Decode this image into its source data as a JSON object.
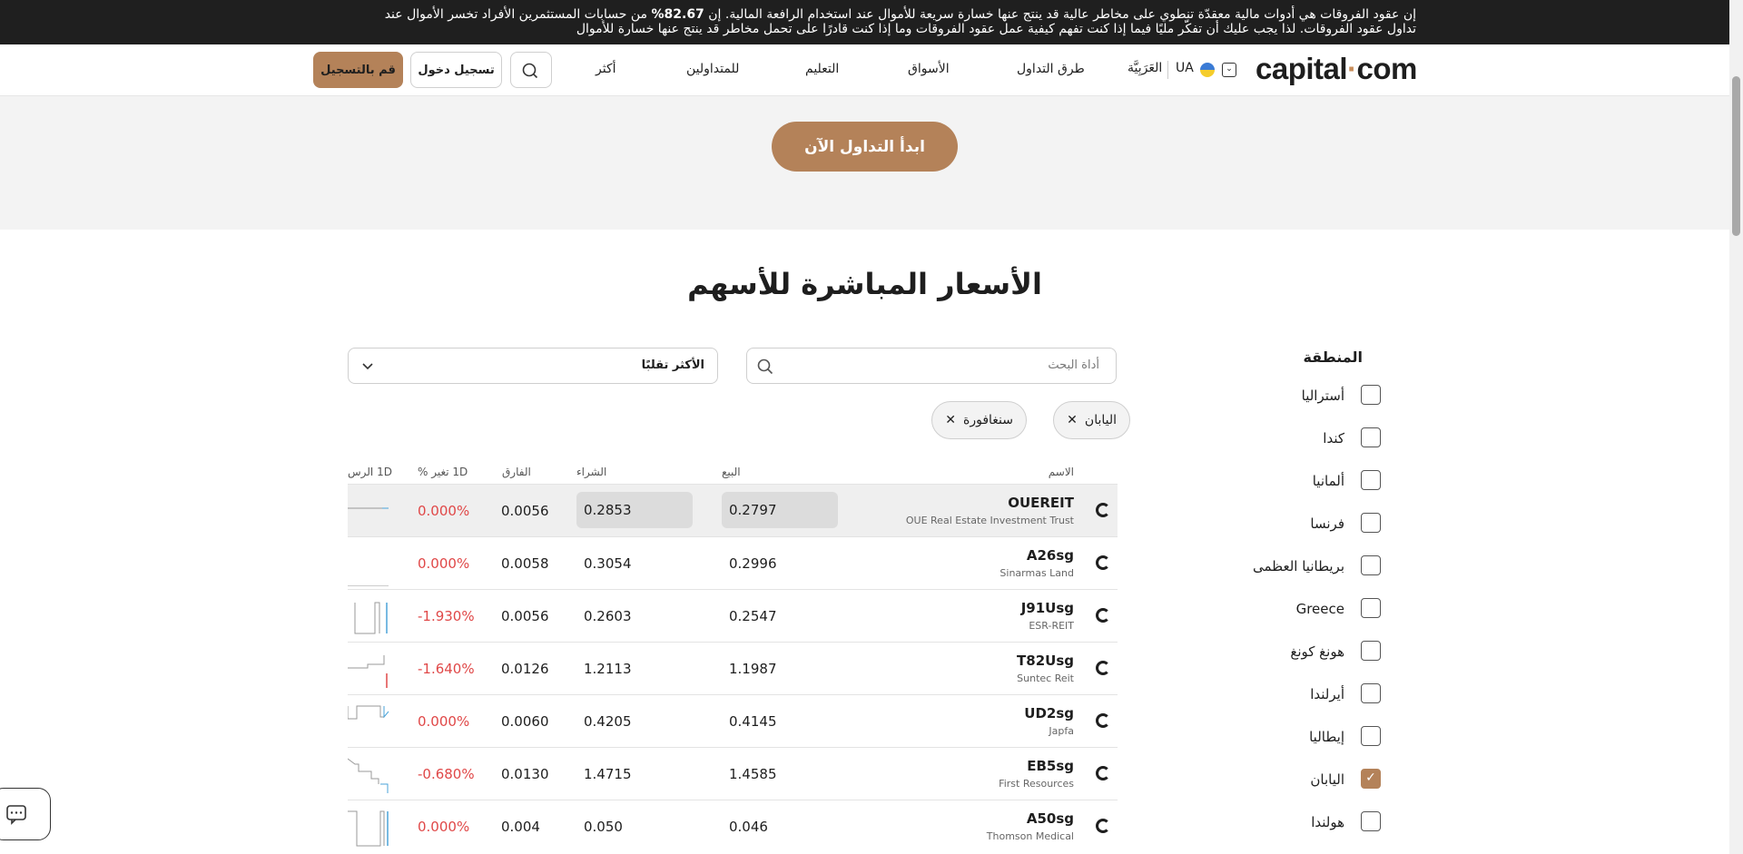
{
  "risk_banner": {
    "before": "إن عقود الفروقات هي أدوات مالية معقدّة تنطوي على مخاطر عالية قد ينتج عنها خسارة سريعة للأموال عند استخدام الرافعة المالية. إن ",
    "percent": "82.67%",
    "after": " من حسابات المستثمرين الأفراد تخسر الأموال عند تداول عقود الفروقات. لذا يجب عليك أن تفكّر مليًا فيما إذا كنت تفهم كيفية عمل عقود الفروقات وما إذا كنت قادرًا على تحمل مخاطر قد ينتج عنها خسارة للأموال"
  },
  "nav": {
    "logo_left": "capital",
    "logo_dot": "·",
    "logo_right": "com",
    "region": "UA",
    "language": "العَرَبِيَّة",
    "items": [
      "طرق التداول",
      "الأسواق",
      "التعليم",
      "للمتداولين",
      "أكثر"
    ],
    "login": "تسجيل دخول",
    "signup": "قم بالتسجيل"
  },
  "hero": {
    "cta": "ابدأ التداول الآن"
  },
  "page_title": "الأسعار المباشرة للأسهم",
  "search": {
    "placeholder": "أداة البحث"
  },
  "sort": {
    "value": "الأكثر تقلبًا"
  },
  "chips": [
    "اليابان",
    "سنغافورة"
  ],
  "filter": {
    "title": "المنطقة",
    "items": [
      {
        "label": "أستراليا",
        "checked": false
      },
      {
        "label": "كندا",
        "checked": false
      },
      {
        "label": "ألمانيا",
        "checked": false
      },
      {
        "label": "فرنسا",
        "checked": false
      },
      {
        "label": "بريطانيا العظمى",
        "checked": false
      },
      {
        "label": "Greece",
        "checked": false
      },
      {
        "label": "هونغ كونغ",
        "checked": false
      },
      {
        "label": "أيرلندا",
        "checked": false
      },
      {
        "label": "إيطاليا",
        "checked": false
      },
      {
        "label": "اليابان",
        "checked": true
      },
      {
        "label": "هولندا",
        "checked": false
      }
    ]
  },
  "table": {
    "headers": {
      "name": "الاسم",
      "sell": "البيع",
      "buy": "الشراء",
      "spread": "الفارق",
      "change": "1D تغير %",
      "chart": "1D الرس"
    },
    "rows": [
      {
        "ticker": "OUEREIT",
        "name": "OUE Real Estate Investment Trust",
        "sell": "0.2797",
        "buy": "0.2853",
        "spread": "0.0056",
        "change": "0.000%"
      },
      {
        "ticker": "A26sg",
        "name": "Sinarmas Land",
        "sell": "0.2996",
        "buy": "0.3054",
        "spread": "0.0058",
        "change": "0.000%"
      },
      {
        "ticker": "J91Usg",
        "name": "ESR-REIT",
        "sell": "0.2547",
        "buy": "0.2603",
        "spread": "0.0056",
        "change": "-1.930%"
      },
      {
        "ticker": "T82Usg",
        "name": "Suntec Reit",
        "sell": "1.1987",
        "buy": "1.2113",
        "spread": "0.0126",
        "change": "-1.640%"
      },
      {
        "ticker": "UD2sg",
        "name": "Japfa",
        "sell": "0.4145",
        "buy": "0.4205",
        "spread": "0.0060",
        "change": "0.000%"
      },
      {
        "ticker": "EB5sg",
        "name": "First Resources",
        "sell": "1.4585",
        "buy": "1.4715",
        "spread": "0.0130",
        "change": "-0.680%"
      },
      {
        "ticker": "A50sg",
        "name": "Thomson Medical",
        "sell": "0.046",
        "buy": "0.050",
        "spread": "0.004",
        "change": "0.000%"
      }
    ]
  },
  "colors": {
    "accent": "#b48259",
    "negative": "#e04848",
    "banner": "#1f1f1f"
  }
}
